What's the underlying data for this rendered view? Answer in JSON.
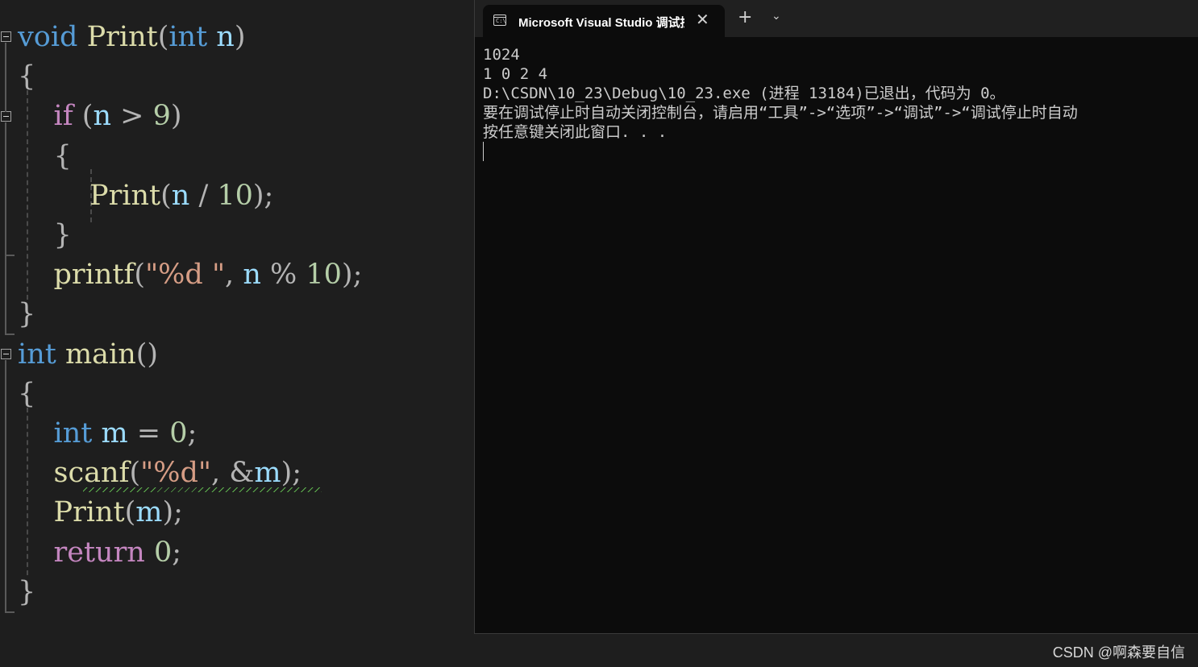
{
  "editor": {
    "lines": [
      [
        {
          "t": "void",
          "c": "k"
        },
        {
          "t": " ",
          "c": "d"
        },
        {
          "t": "Print",
          "c": "f"
        },
        {
          "t": "(",
          "c": "d"
        },
        {
          "t": "int",
          "c": "k"
        },
        {
          "t": " ",
          "c": "d"
        },
        {
          "t": "n",
          "c": "p"
        },
        {
          "t": ")",
          "c": "d"
        }
      ],
      [
        {
          "t": "{",
          "c": "d"
        }
      ],
      [
        {
          "t": "    ",
          "c": "d"
        },
        {
          "t": "if",
          "c": "c"
        },
        {
          "t": " (",
          "c": "d"
        },
        {
          "t": "n",
          "c": "p"
        },
        {
          "t": " > ",
          "c": "d"
        },
        {
          "t": "9",
          "c": "n"
        },
        {
          "t": ")",
          "c": "d"
        }
      ],
      [
        {
          "t": "    {",
          "c": "d"
        }
      ],
      [
        {
          "t": "        ",
          "c": "d"
        },
        {
          "t": "Print",
          "c": "f"
        },
        {
          "t": "(",
          "c": "d"
        },
        {
          "t": "n",
          "c": "p"
        },
        {
          "t": " / ",
          "c": "d"
        },
        {
          "t": "10",
          "c": "n"
        },
        {
          "t": ");",
          "c": "d"
        }
      ],
      [
        {
          "t": "    }",
          "c": "d"
        }
      ],
      [
        {
          "t": "    ",
          "c": "d"
        },
        {
          "t": "printf",
          "c": "f"
        },
        {
          "t": "(",
          "c": "d"
        },
        {
          "t": "\"%d \"",
          "c": "s"
        },
        {
          "t": ", ",
          "c": "d"
        },
        {
          "t": "n",
          "c": "p"
        },
        {
          "t": " % ",
          "c": "d"
        },
        {
          "t": "10",
          "c": "n"
        },
        {
          "t": ");",
          "c": "d"
        }
      ],
      [
        {
          "t": "}",
          "c": "d"
        }
      ],
      [
        {
          "t": "int",
          "c": "k"
        },
        {
          "t": " ",
          "c": "d"
        },
        {
          "t": "main",
          "c": "f"
        },
        {
          "t": "()",
          "c": "d"
        }
      ],
      [
        {
          "t": "{",
          "c": "d"
        }
      ],
      [
        {
          "t": "    ",
          "c": "d"
        },
        {
          "t": "int",
          "c": "k"
        },
        {
          "t": " ",
          "c": "d"
        },
        {
          "t": "m",
          "c": "v"
        },
        {
          "t": " = ",
          "c": "d"
        },
        {
          "t": "0",
          "c": "n"
        },
        {
          "t": ";",
          "c": "d"
        }
      ],
      [
        {
          "t": "    ",
          "c": "d"
        },
        {
          "t": "scanf",
          "c": "f"
        },
        {
          "t": "(",
          "c": "d"
        },
        {
          "t": "\"%d\"",
          "c": "s"
        },
        {
          "t": ", &",
          "c": "d"
        },
        {
          "t": "m",
          "c": "v"
        },
        {
          "t": ");",
          "c": "d"
        }
      ],
      [
        {
          "t": "    ",
          "c": "d"
        },
        {
          "t": "Print",
          "c": "f"
        },
        {
          "t": "(",
          "c": "d"
        },
        {
          "t": "m",
          "c": "v"
        },
        {
          "t": ");",
          "c": "d"
        }
      ],
      [
        {
          "t": "    ",
          "c": "d"
        },
        {
          "t": "return",
          "c": "c"
        },
        {
          "t": " ",
          "c": "d"
        },
        {
          "t": "0",
          "c": "n"
        },
        {
          "t": ";",
          "c": "d"
        }
      ],
      [
        {
          "t": "}",
          "c": "d"
        }
      ]
    ]
  },
  "console": {
    "tab_title": "Microsoft Visual Studio 调试控制台",
    "tab_icon": "terminal-icon",
    "tab_icon_text": "C:\\",
    "close_glyph": "✕",
    "new_tab_glyph": "+",
    "dropdown_glyph": "⌄",
    "output": [
      "1024",
      "1 0 2 4",
      "D:\\CSDN\\10_23\\Debug\\10_23.exe (进程 13184)已退出，代码为 0。",
      "要在调试停止时自动关闭控制台，请启用“工具”->“选项”->“调试”->“调试停止时自动",
      "按任意键关闭此窗口. . ."
    ]
  },
  "watermark": "CSDN @啊森要自信",
  "colors": {
    "editor_bg": "#1e1e1e",
    "console_bg": "#0c0c0c",
    "keyword": "#569cd6",
    "function": "#dcdcaa",
    "string": "#d69d85",
    "number": "#b5cea8",
    "control": "#c586c0"
  }
}
